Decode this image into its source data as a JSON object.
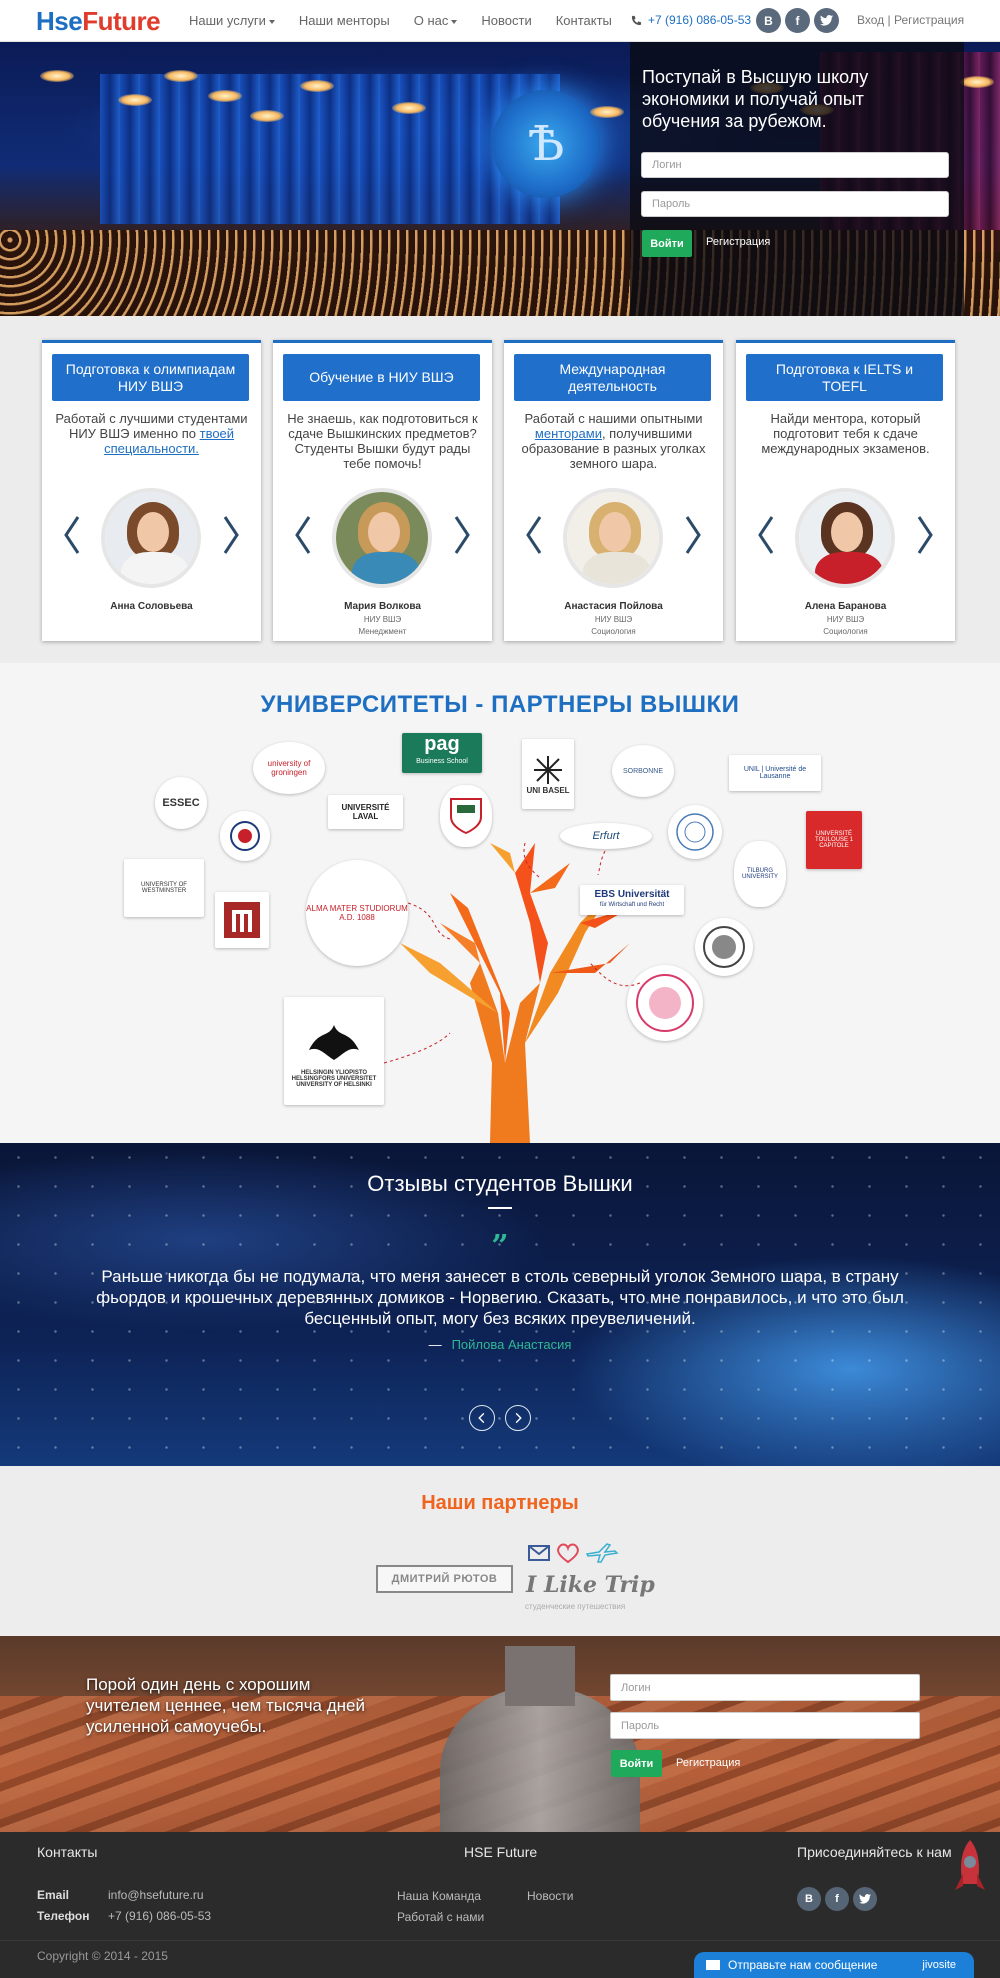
{
  "nav": {
    "logo_a": "Hse",
    "logo_b": "Future",
    "items": [
      "Наши услуги",
      "Наши менторы",
      "О нас",
      "Новости",
      "Контакты"
    ],
    "phone": "+7 (916) 086-05-53",
    "social": [
      "В",
      "f",
      "t"
    ],
    "login": "Вход",
    "sep": "|",
    "register": "Регистрация"
  },
  "hero": {
    "title": "Поступай в Высшую школу экономики и получай опыт обучения за рубежом.",
    "login_placeholder": "Логин",
    "password_placeholder": "Пароль",
    "submit": "Войти",
    "register": "Регистрация",
    "emblem": "Ѣ"
  },
  "cards": [
    {
      "header": "Подготовка к олимпиадам НИУ ВШЭ",
      "text": "Работай с лучшими студентами НИУ ВШЭ именно по ",
      "link": "твоей специальности.",
      "text_after": "",
      "name": "Анна Соловьева",
      "uni": "",
      "dept": ""
    },
    {
      "header": "Обучение в НИУ ВШЭ",
      "text": "Не знаешь, как подготовиться к сдаче Вышкинских предметов? Студенты Вышки будут рады тебе помочь!",
      "link": "",
      "text_after": "",
      "name": "Мария Волкова",
      "uni": "НИУ ВШЭ",
      "dept": "Менеджмент"
    },
    {
      "header": "Международная деятельность",
      "text": "Работай с нашими опытными ",
      "link": "менторами",
      "text_after": ", получившими образование в разных уголках земного шара.",
      "name": "Анастасия Пойлова",
      "uni": "НИУ ВШЭ",
      "dept": "Социология"
    },
    {
      "header": "Подготовка к IELTS и TOEFL",
      "text": "Найди ментора, который подготовит тебя к сдаче международных экзаменов.",
      "link": "",
      "text_after": "",
      "name": "Алена Баранова",
      "uni": "НИУ ВШЭ",
      "dept": "Социология"
    }
  ],
  "universities": {
    "title": "УНИВЕРСИТЕТЫ - ПАРТНЕРЫ ВЫШКИ",
    "logos": {
      "pag": "pag",
      "pag_sub": "Business School",
      "groningen": "university of groningen",
      "essec": "ESSEC",
      "laval": "UNIVERSITÉ LAVAL",
      "basel": "UNI BASEL",
      "sorbonne": "SORBONNE",
      "lausanne": "UNIL | Université de Lausanne",
      "toulouse": "UNIVERSITÉ TOULOUSE 1 CAPITOLE",
      "tilburg": "TILBURG UNIVERSITY",
      "bologna": "ALMA MATER STUDIORUM A.D. 1088",
      "ebs": "EBS Universität",
      "ebs_sub": "für Wirtschaft und Recht",
      "erfurt": "Erfurt",
      "westminster": "UNIVERSITY OF WESTMINSTER",
      "helsinki": "HELSINGIN YLIOPISTO HELSINGFORS UNIVERSITET UNIVERSITY OF HELSINKI"
    }
  },
  "reviews": {
    "title": "Отзывы студентов Вышки",
    "quote_mark": "”",
    "text": "Раньше никогда бы не подумала, что меня занесет в столь северный уголок Земного шара, в страну фьордов и крошечных деревянных домиков - Норвегию. Сказать, что мне понравилось, и что это был бесценный опыт, могу без всяких преувеличений.",
    "author_dash": "—",
    "author": "Пойлова Анастасия"
  },
  "partners": {
    "title": "Наши партнеры",
    "partner1": "ДМИТРИЙ РЮТОВ",
    "partner2": "I Like Trip",
    "partner2_sub": "студенческие путешествия"
  },
  "footer_hero": {
    "text": "Порой один день с хорошим учителем ценнее, чем тысяча дней усиленной самоучебы.",
    "login_placeholder": "Логин",
    "password_placeholder": "Пароль",
    "submit": "Войти",
    "register": "Регистрация"
  },
  "footer": {
    "contacts_title": "Контакты",
    "email_label": "Email",
    "email": "info@hsefuture.ru",
    "phone_label": "Телефон",
    "phone": "+7 (916) 086-05-53",
    "brand_title": "HSE Future",
    "links": [
      "Наша Команда",
      "Новости",
      "Работай с нами"
    ],
    "join_title": "Присоединяйтесь к нам",
    "social": [
      "В",
      "f",
      "t"
    ],
    "copyright": "Copyright © 2014 - 2015",
    "chat": "Отправьте нам сообщение",
    "chat_brand": "jivosite"
  },
  "colors": {
    "brand_blue": "#1e6fc2",
    "brand_red": "#e03c2c",
    "green": "#1fa95a",
    "orange": "#f0641e",
    "teal": "#2eb895"
  }
}
